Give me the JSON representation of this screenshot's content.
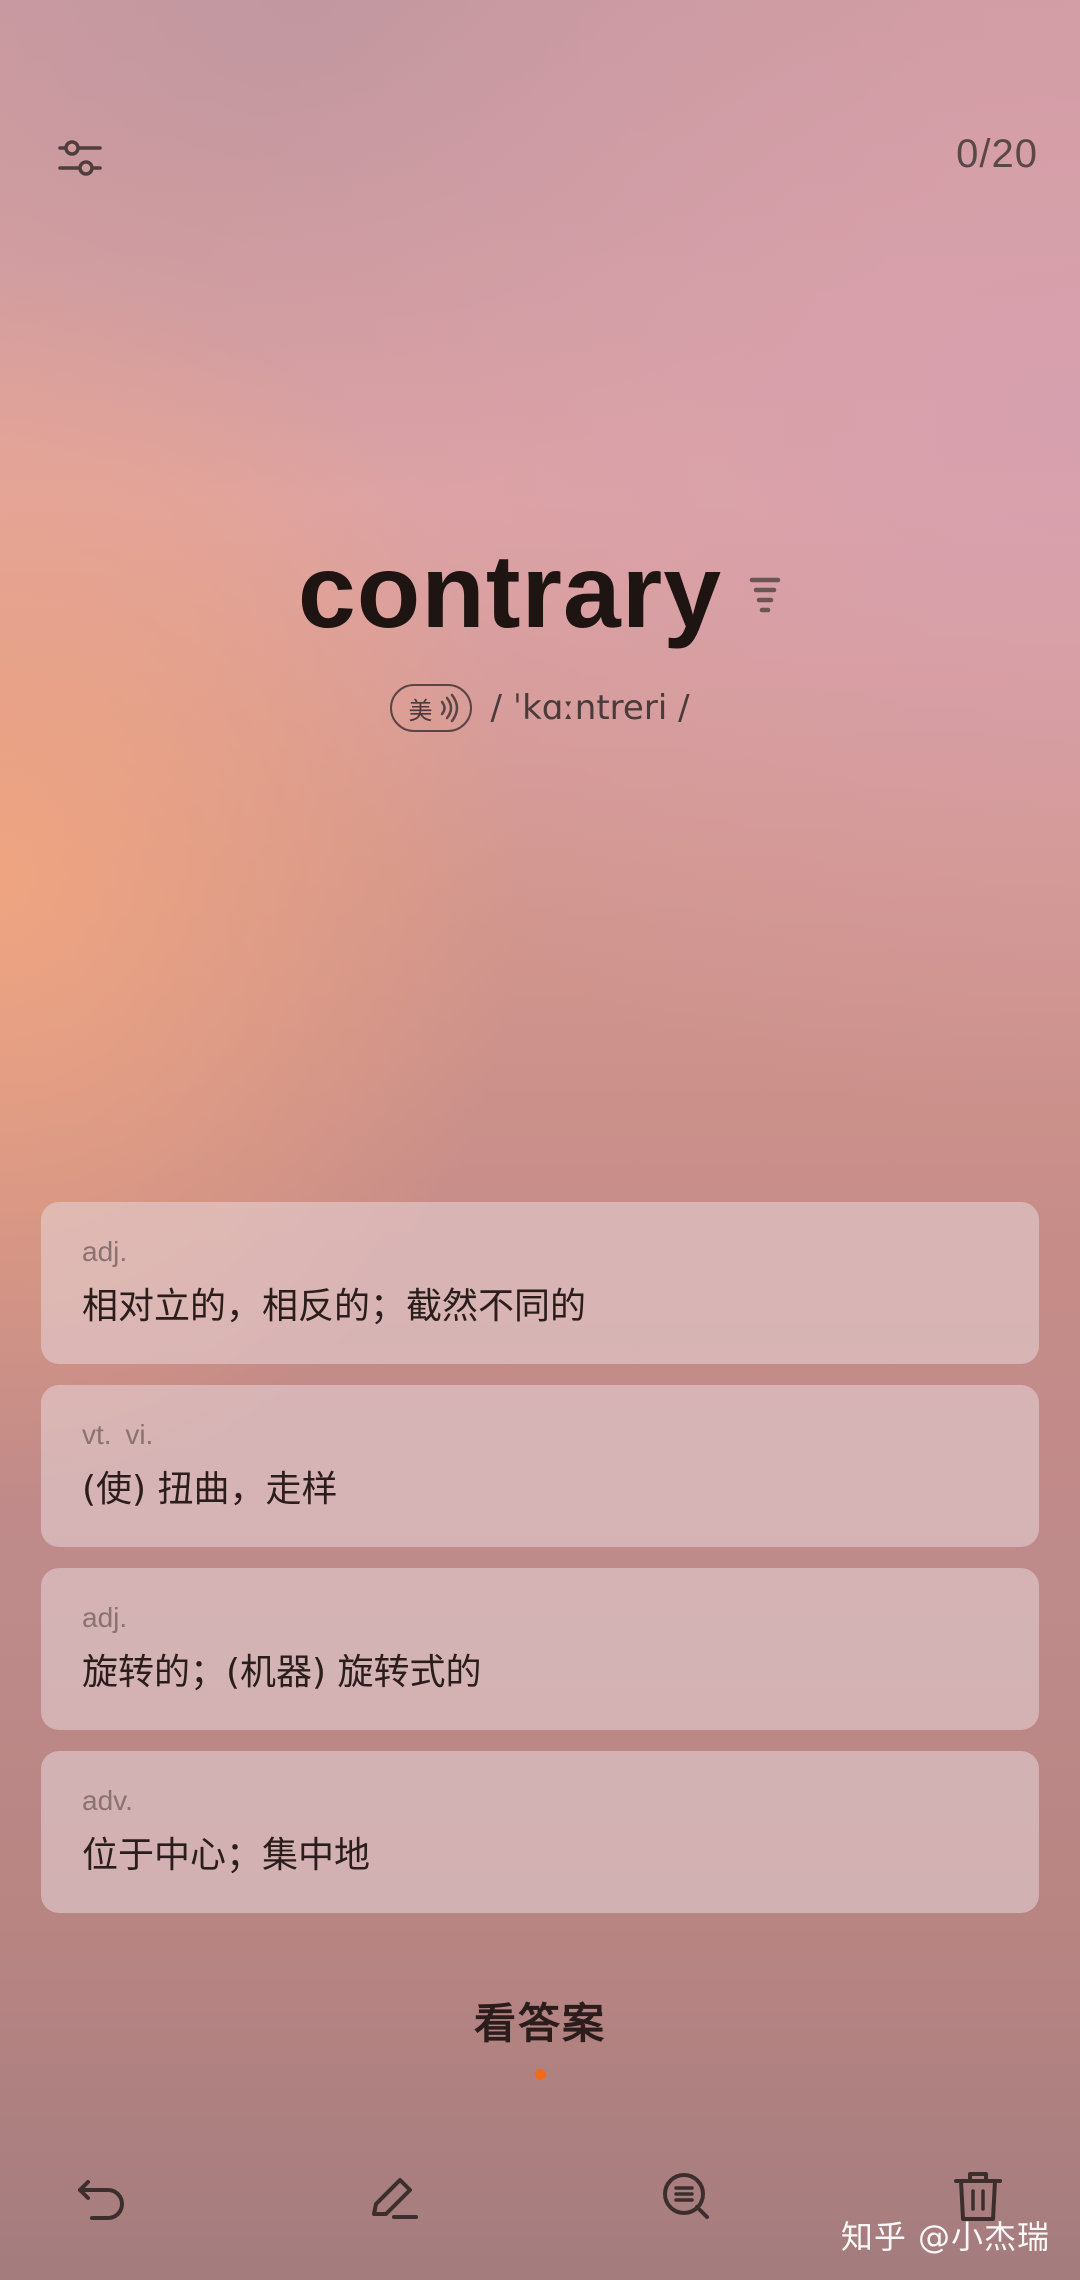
{
  "header": {
    "settings_icon": "sliders-icon",
    "progress": "0/20"
  },
  "word": {
    "text": "contrary",
    "frequency_icon": "frequency-icon",
    "accent_label": "美",
    "phonetic": "/ ˈkɑːntreri /"
  },
  "definitions": [
    {
      "pos": "adj.",
      "meaning": "相对立的，相反的；截然不同的"
    },
    {
      "pos": "vt.  vi.",
      "meaning": "(使) 扭曲，走样"
    },
    {
      "pos": "adj.",
      "meaning": "旋转的；(机器) 旋转式的"
    },
    {
      "pos": "adv.",
      "meaning": "位于中心；集中地"
    }
  ],
  "answer": {
    "label": "看答案"
  },
  "toolbar": {
    "undo_icon": "undo-icon",
    "edit_icon": "edit-icon",
    "search_icon": "search-list-icon",
    "delete_icon": "trash-icon"
  },
  "watermark": "知乎 @小杰瑞",
  "colors": {
    "accent_dot": "#f06a1a",
    "text_dark": "#1e1412"
  }
}
